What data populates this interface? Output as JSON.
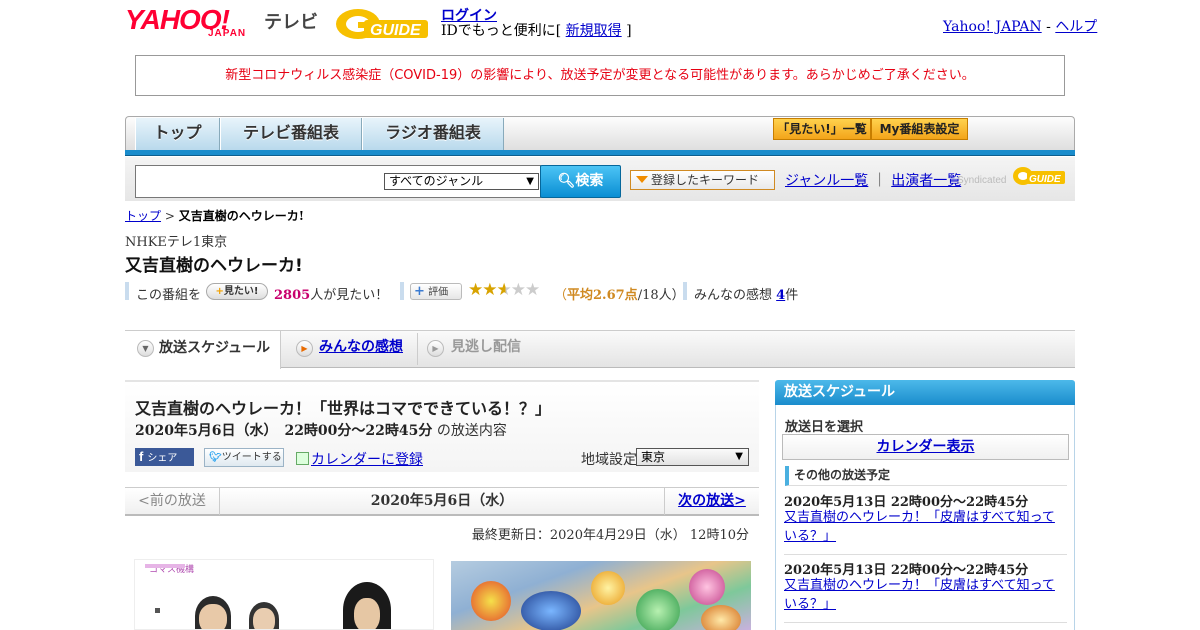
{
  "header": {
    "yahoo": "YAHOO!",
    "japan": "JAPAN",
    "tv": "テレビ",
    "gguide": "GUIDE",
    "login": "ログイン",
    "login_sub_pre": "IDでもっと便利に[ ",
    "register": "新規取得",
    "login_sub_post": " ]",
    "yahoo_japan_link": "Yahoo! JAPAN",
    "sep": " - ",
    "help": "ヘルプ"
  },
  "notice": "新型コロナウィルス感染症（COVID-19）の影響により、放送予定が変更となる可能性があります。あらかじめご了承ください。",
  "nav": {
    "tabs": [
      "トップ",
      "テレビ番組表",
      "ラジオ番組表"
    ],
    "mitai_list": "「見たい!」一覧",
    "my_schedule": "My番組表設定"
  },
  "search": {
    "placeholder": "",
    "genre": "すべてのジャンル",
    "button": "検索",
    "keyword_btn": "登録したキーワード",
    "genre_list": "ジャンル一覧",
    "divider": "｜",
    "performer_list": "出演者一覧",
    "syndicated": "Syndicated"
  },
  "breadcrumb": {
    "top": "トップ",
    "sep": " > ",
    "current": "又吉直樹のヘウレーカ!"
  },
  "program": {
    "channel": "NHKEテレ1東京",
    "title": "又吉直樹のヘウレーカ!",
    "mitai_prefix": "この番組を",
    "mitai_btn": "見たい!",
    "mitai_count": "2805",
    "mitai_suffix": "人が見たい！",
    "hyoka_btn": "評価",
    "rating": 2.67,
    "rating_text_pre": "（",
    "rating_avg": "平均2.67点",
    "rating_text_post": "/18人）",
    "kanso_label": "みんなの感想",
    "kanso_count": "4",
    "kanso_unit": "件"
  },
  "subtabs": {
    "schedule": "放送スケジュール",
    "reviews": "みんなの感想",
    "vod": "見逃し配信"
  },
  "episode": {
    "title": "又吉直樹のヘウレーカ！「世界はコマでできている！？」",
    "datetime": "2020年5月6日（水）　22時00分～22時45分",
    "suffix": "の放送内容",
    "share_fb": "シェア",
    "share_tw": "ツイートする",
    "calendar_register": "カレンダーに登録",
    "region_label": "地域設定",
    "region_value": "東京",
    "prev": "<前の放送",
    "current_date": "2020年5月6日（水）",
    "next": "次の放送>",
    "updated": "最終更新日：2020年4月29日（水）  12時10分",
    "img1_caption": "コマス機構"
  },
  "sidebar": {
    "title": "放送スケジュール",
    "date_label": "放送日を選択",
    "calendar_btn": "カレンダー表示",
    "other_head": "その他の放送予定",
    "items": [
      {
        "date": "2020年5月13日  22時00分～22時45分",
        "title": "又吉直樹のヘウレーカ！「皮膚はすべて知っている？」"
      },
      {
        "date": "2020年5月13日  22時00分～22時45分",
        "title": "又吉直樹のヘウレーカ！「皮膚はすべて知っている？」"
      }
    ]
  },
  "colors": {
    "accent_blue": "#1a8ccc",
    "notice_red": "#e60012",
    "link": "#0000cc",
    "star": "#d8a300"
  }
}
